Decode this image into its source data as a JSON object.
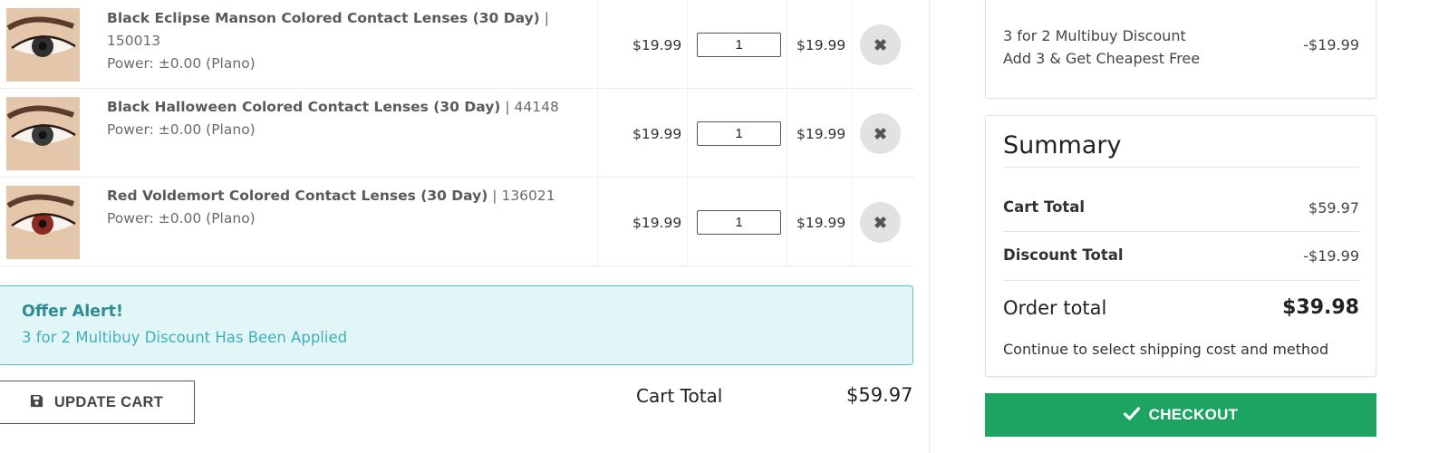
{
  "cart": {
    "items": [
      {
        "name": "Black Eclipse Manson Colored Contact Lenses (30 Day)",
        "sku": "150013",
        "power": "Power: ±0.00 (Plano)",
        "price": "$19.99",
        "qty": "1",
        "line_total": "$19.99",
        "iris_color": "#2f2f2f"
      },
      {
        "name": "Black Halloween Colored Contact Lenses (30 Day)",
        "sku": "44148",
        "power": "Power: ±0.00 (Plano)",
        "price": "$19.99",
        "qty": "1",
        "line_total": "$19.99",
        "iris_color": "#3a3a3a"
      },
      {
        "name": "Red Voldemort Colored Contact Lenses (30 Day)",
        "sku": "136021",
        "power": "Power: ±0.00 (Plano)",
        "price": "$19.99",
        "qty": "1",
        "line_total": "$19.99",
        "iris_color": "#8a2a22"
      }
    ],
    "separator": "|",
    "remove_icon": "close-icon",
    "offer": {
      "title": "Offer Alert!",
      "text": "3 for 2 Multibuy Discount Has Been Applied"
    },
    "update_label": "UPDATE CART",
    "update_icon": "save-icon",
    "total_label": "Cart Total",
    "total_value": "$59.97"
  },
  "discount": {
    "line1": "3 for 2 Multibuy Discount",
    "line2": "Add 3 & Get Cheapest Free",
    "amount": "-$19.99"
  },
  "summary": {
    "title": "Summary",
    "cart_total_label": "Cart Total",
    "cart_total_value": "$59.97",
    "discount_total_label": "Discount Total",
    "discount_total_value": "-$19.99",
    "order_total_label": "Order total",
    "order_total_value": "$39.98",
    "shipping_note": "Continue to select shipping cost and method"
  },
  "checkout": {
    "label": "CHECKOUT",
    "icon": "checkmark-icon"
  },
  "colors": {
    "checkout": "#1ea462",
    "offer_bg": "#e2f6f7",
    "offer_border": "#56c3c9",
    "offer_title": "#2d8d93",
    "offer_text": "#3fb0b7"
  }
}
